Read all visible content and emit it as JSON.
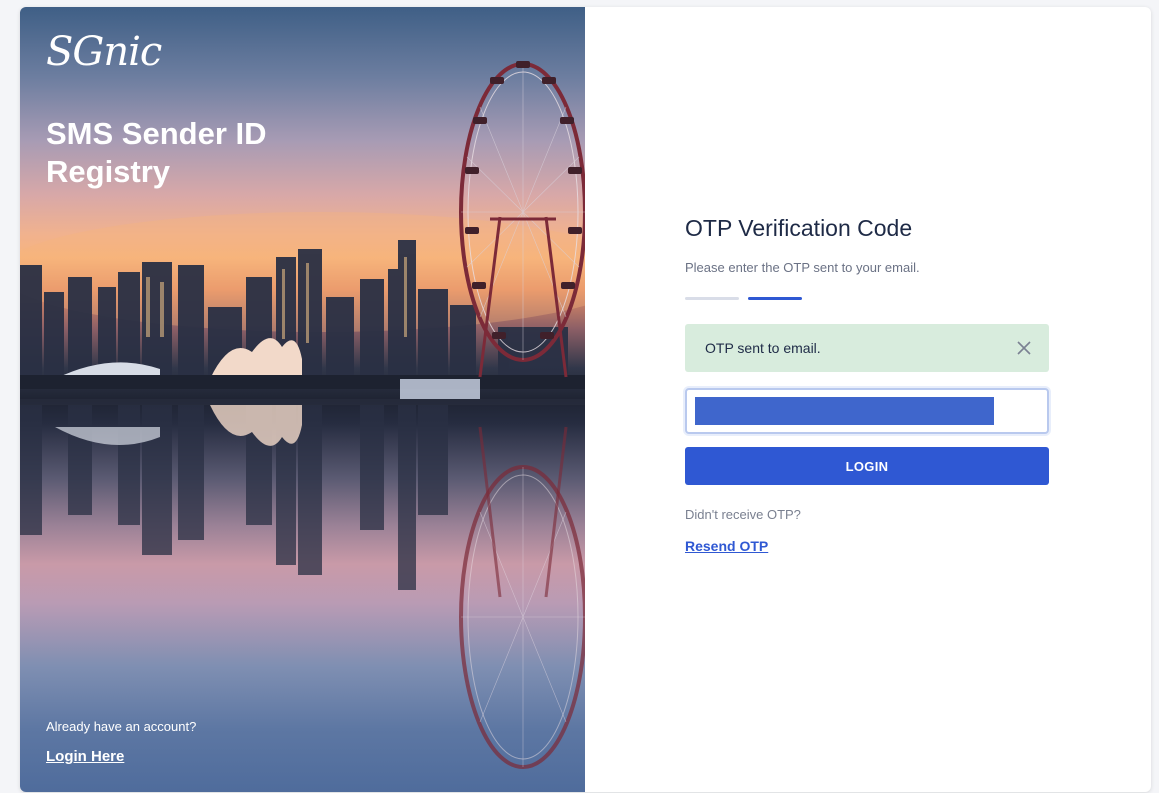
{
  "hero": {
    "logo_text": "SGnic",
    "title": "SMS Sender ID Registry",
    "account_prompt": "Already have an account?",
    "login_link": "Login Here"
  },
  "form": {
    "title": "OTP Verification Code",
    "subtitle": "Please enter the OTP sent to your email.",
    "steps": [
      "step-1",
      "step-2"
    ],
    "active_step": 2,
    "alert_text": "OTP sent to email.",
    "otp_value": "",
    "login_button": "LOGIN",
    "no_receive_text": "Didn't receive OTP?",
    "resend_link": "Resend OTP"
  },
  "colors": {
    "accent": "#2f58d3",
    "alert_bg": "#d8ecdd",
    "title_text": "#1e2a46",
    "muted_text": "#6b7285"
  },
  "icons": {
    "alert_close": "close-icon"
  }
}
